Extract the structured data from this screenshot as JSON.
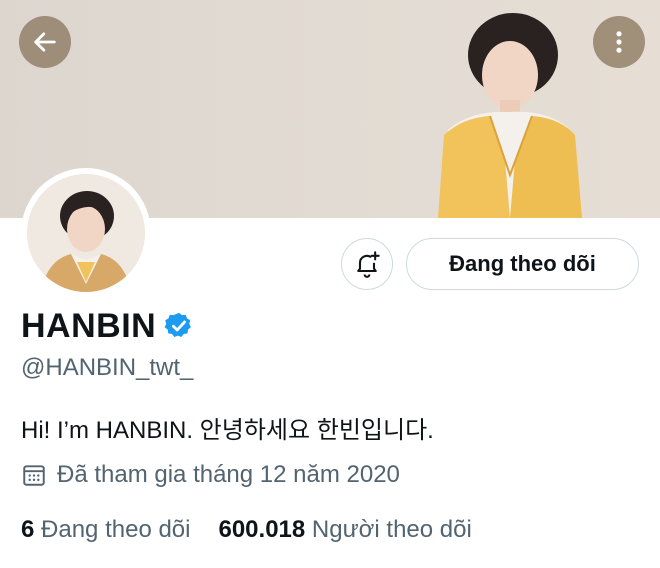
{
  "header": {
    "back_icon": "arrow-left-icon",
    "more_icon": "more-vertical-icon"
  },
  "profile": {
    "display_name": "HANBIN",
    "verified_icon": "verified-badge-icon",
    "handle": "@HANBIN_twt_",
    "bio": "Hi! I’m HANBIN. 안녕하세요 한빈입니다.",
    "joined_icon": "calendar-icon",
    "joined_text": "Đã tham gia tháng 12 năm 2020"
  },
  "actions": {
    "notify_icon": "bell-plus-icon",
    "follow_label": "Đang theo dõi"
  },
  "stats": {
    "following_count": "6",
    "following_label": "Đang theo dõi",
    "followers_count": "600.018",
    "followers_label": "Người theo dõi"
  },
  "colors": {
    "text": "#0f1419",
    "muted": "#536471",
    "verified": "#1d9bf0",
    "border": "#cfd9de",
    "banner_bg": "#e2dbd3",
    "overlay_button": "#8c785f"
  }
}
